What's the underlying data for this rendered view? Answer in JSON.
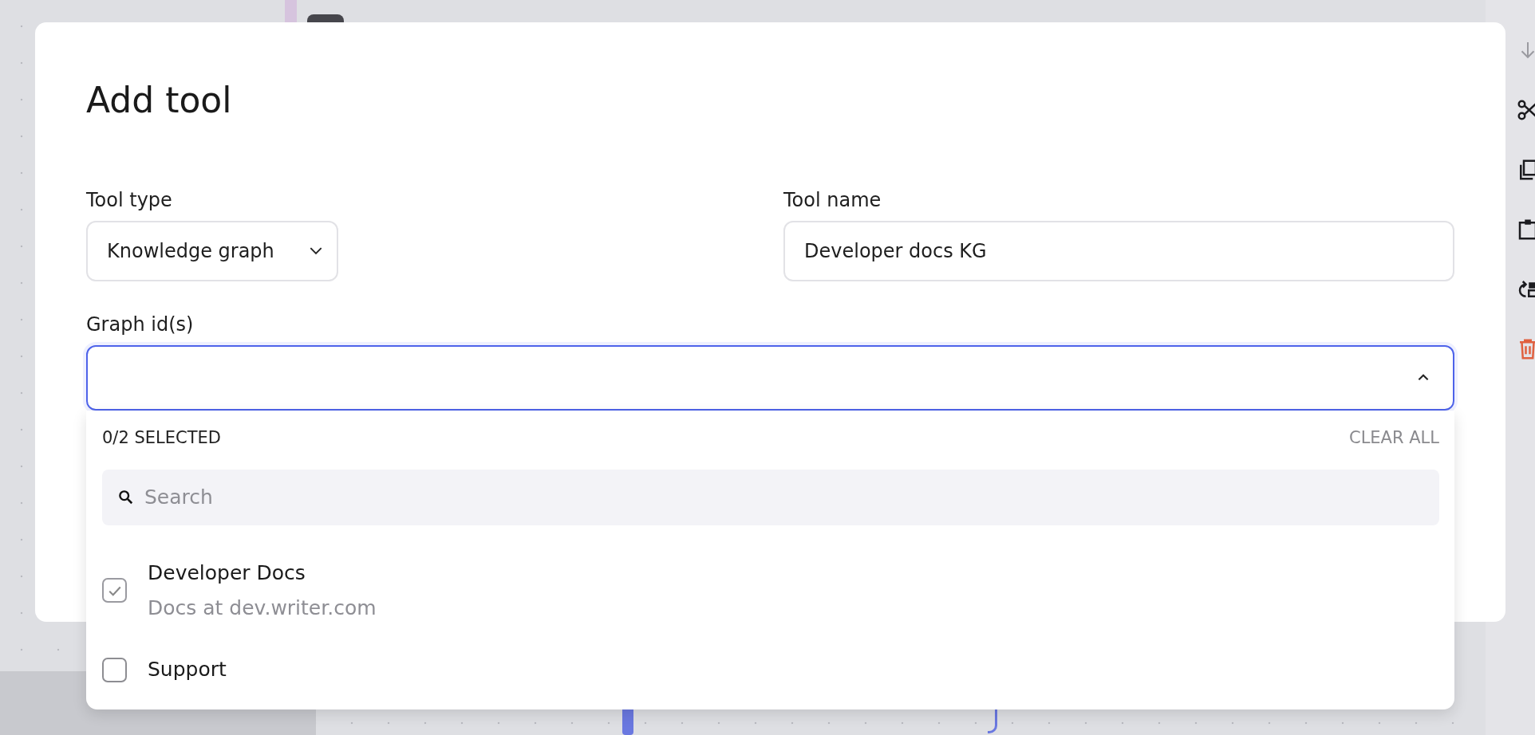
{
  "dialog": {
    "title": "Add tool",
    "tool_type": {
      "label": "Tool type",
      "value": "Knowledge graph"
    },
    "tool_name": {
      "label": "Tool name",
      "value": "Developer docs KG"
    },
    "graph_ids": {
      "label": "Graph id(s)",
      "expanded": true
    }
  },
  "dropdown": {
    "count": "0/2 SELECTED",
    "clear_button": "CLEAR ALL",
    "search": {
      "placeholder": "Search"
    },
    "options": [
      {
        "title": "Developer Docs",
        "description": "Docs at dev.writer.com",
        "checked": true
      },
      {
        "title": "Support",
        "checked": false
      }
    ]
  },
  "toolbar": {
    "items": [
      {
        "kind": "move-down",
        "disabled": true
      },
      {
        "kind": "cut",
        "disabled": false
      },
      {
        "kind": "copy",
        "disabled": false
      },
      {
        "kind": "paste",
        "disabled": false
      },
      {
        "kind": "wrap",
        "disabled": false
      },
      {
        "kind": "delete",
        "disabled": false
      }
    ]
  }
}
